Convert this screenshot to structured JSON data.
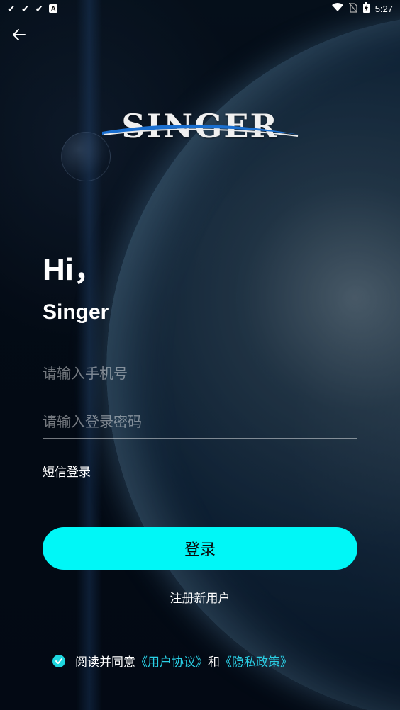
{
  "status_bar": {
    "time": "5:27",
    "left_icons": [
      "check-icon",
      "check-icon",
      "check-icon",
      "a-icon"
    ],
    "right_icons": [
      "wifi-icon",
      "no-sim-icon",
      "battery-icon"
    ]
  },
  "header": {
    "back_icon": "arrow-left-icon"
  },
  "logo": {
    "text": "SINGER"
  },
  "greeting": {
    "hi": "Hi，",
    "name": "Singer"
  },
  "form": {
    "phone_placeholder": "请输入手机号",
    "password_placeholder": "请输入登录密码",
    "sms_login_label": "短信登录",
    "login_button": "登录",
    "register_link": "注册新用户"
  },
  "agreement": {
    "checked": true,
    "prefix": "阅读并同意",
    "user_agreement": "《用户协议》",
    "and": "和",
    "privacy_policy": "《隐私政策》"
  },
  "colors": {
    "accent": "#00f7f7",
    "link": "#2ad0e6",
    "checkbox": "#1ed7e0",
    "background": "#050a14"
  }
}
